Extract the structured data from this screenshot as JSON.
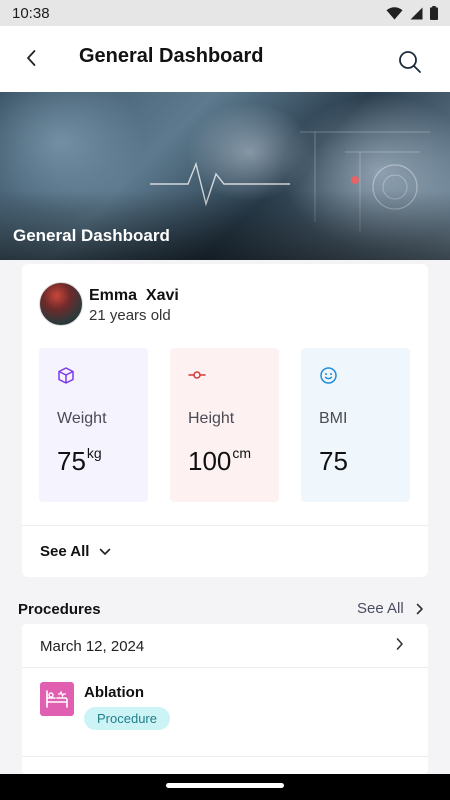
{
  "status_bar": {
    "time": "10:38"
  },
  "header": {
    "title": "General Dashboard"
  },
  "banner": {
    "title": "General Dashboard"
  },
  "profile": {
    "name": "Emma  Xavi",
    "age": "21 years old",
    "metrics": [
      {
        "label": "Weight",
        "value": "75",
        "unit": "kg",
        "icon": "cube-icon",
        "color": "#7c3aed",
        "bg": "#f4f3fe"
      },
      {
        "label": "Height",
        "value": "100",
        "unit": "cm",
        "icon": "ruler-icon",
        "color": "#d43a3a",
        "bg": "#fdf1f1"
      },
      {
        "label": "BMI",
        "value": "75",
        "unit": "",
        "icon": "smile-icon",
        "color": "#1f8fd8",
        "bg": "#eff6fc"
      }
    ],
    "see_all": "See All"
  },
  "procedures": {
    "title": "Procedures",
    "see_all": "See All",
    "date": "March 12, 2024",
    "items": [
      {
        "name": "Ablation",
        "badge": "Procedure",
        "icon": "bed-icon"
      }
    ]
  }
}
